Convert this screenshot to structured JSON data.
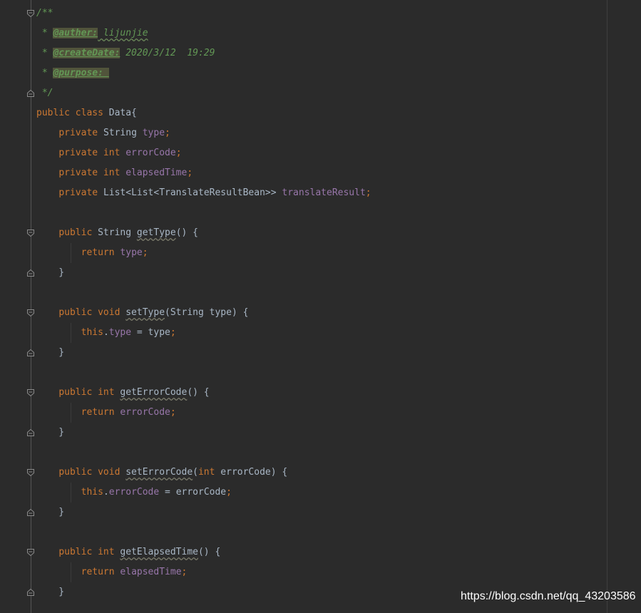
{
  "editor": {
    "lines": [
      {
        "fold": "open",
        "tokens": [
          [
            "cm",
            "/**"
          ]
        ]
      },
      {
        "tokens": [
          [
            "cm",
            " * "
          ],
          [
            "tag",
            "@auther:"
          ],
          [
            "cm-typo",
            " lijunjie"
          ]
        ]
      },
      {
        "tokens": [
          [
            "cm",
            " * "
          ],
          [
            "tag",
            "@createDate:"
          ],
          [
            "cm",
            " 2020/3/12  19:29"
          ]
        ]
      },
      {
        "tokens": [
          [
            "cm",
            " * "
          ],
          [
            "tag",
            "@purpose: "
          ]
        ]
      },
      {
        "fold": "close",
        "tokens": [
          [
            "cm",
            " */"
          ]
        ]
      },
      {
        "tokens": [
          [
            "kw",
            "public class "
          ],
          [
            "pl",
            "Data{"
          ]
        ]
      },
      {
        "tokens": [
          [
            "pl",
            "    "
          ],
          [
            "kw",
            "private "
          ],
          [
            "pl",
            "String "
          ],
          [
            "fld",
            "type"
          ],
          [
            "punc",
            ";"
          ]
        ]
      },
      {
        "tokens": [
          [
            "pl",
            "    "
          ],
          [
            "kw",
            "private int "
          ],
          [
            "fld",
            "errorCode"
          ],
          [
            "punc",
            ";"
          ]
        ]
      },
      {
        "tokens": [
          [
            "pl",
            "    "
          ],
          [
            "kw",
            "private int "
          ],
          [
            "fld",
            "elapsedTime"
          ],
          [
            "punc",
            ";"
          ]
        ]
      },
      {
        "tokens": [
          [
            "pl",
            "    "
          ],
          [
            "kw",
            "private "
          ],
          [
            "pl",
            "List<List<TranslateResultBean>> "
          ],
          [
            "fld",
            "translateResult"
          ],
          [
            "punc",
            ";"
          ]
        ]
      },
      {
        "tokens": []
      },
      {
        "fold": "open",
        "tokens": [
          [
            "pl",
            "    "
          ],
          [
            "kw",
            "public "
          ],
          [
            "pl",
            "String "
          ],
          [
            "meth",
            "getType"
          ],
          [
            "pl",
            "() {"
          ]
        ]
      },
      {
        "tokens": [
          [
            "pl",
            "        "
          ],
          [
            "kw",
            "return "
          ],
          [
            "fld",
            "type"
          ],
          [
            "punc",
            ";"
          ]
        ]
      },
      {
        "fold": "close",
        "tokens": [
          [
            "pl",
            "    }"
          ]
        ]
      },
      {
        "tokens": []
      },
      {
        "fold": "open",
        "tokens": [
          [
            "pl",
            "    "
          ],
          [
            "kw",
            "public void "
          ],
          [
            "meth",
            "setType"
          ],
          [
            "pl",
            "(String type) {"
          ]
        ]
      },
      {
        "tokens": [
          [
            "pl",
            "        "
          ],
          [
            "kw",
            "this"
          ],
          [
            "pl",
            "."
          ],
          [
            "fld",
            "type"
          ],
          [
            "pl",
            " = type"
          ],
          [
            "punc",
            ";"
          ]
        ]
      },
      {
        "fold": "close",
        "tokens": [
          [
            "pl",
            "    }"
          ]
        ]
      },
      {
        "tokens": []
      },
      {
        "fold": "open",
        "tokens": [
          [
            "pl",
            "    "
          ],
          [
            "kw",
            "public int "
          ],
          [
            "meth",
            "getErrorCode"
          ],
          [
            "pl",
            "() {"
          ]
        ]
      },
      {
        "tokens": [
          [
            "pl",
            "        "
          ],
          [
            "kw",
            "return "
          ],
          [
            "fld",
            "errorCode"
          ],
          [
            "punc",
            ";"
          ]
        ]
      },
      {
        "fold": "close",
        "tokens": [
          [
            "pl",
            "    }"
          ]
        ]
      },
      {
        "tokens": []
      },
      {
        "fold": "open",
        "tokens": [
          [
            "pl",
            "    "
          ],
          [
            "kw",
            "public void "
          ],
          [
            "meth",
            "setErrorCode"
          ],
          [
            "pl",
            "("
          ],
          [
            "kw",
            "int "
          ],
          [
            "pl",
            "errorCode) {"
          ]
        ]
      },
      {
        "tokens": [
          [
            "pl",
            "        "
          ],
          [
            "kw",
            "this"
          ],
          [
            "pl",
            "."
          ],
          [
            "fld",
            "errorCode"
          ],
          [
            "pl",
            " = errorCode"
          ],
          [
            "punc",
            ";"
          ]
        ]
      },
      {
        "fold": "close",
        "tokens": [
          [
            "pl",
            "    }"
          ]
        ]
      },
      {
        "tokens": []
      },
      {
        "fold": "open",
        "tokens": [
          [
            "pl",
            "    "
          ],
          [
            "kw",
            "public int "
          ],
          [
            "meth",
            "getElapsedTime"
          ],
          [
            "pl",
            "() {"
          ]
        ]
      },
      {
        "tokens": [
          [
            "pl",
            "        "
          ],
          [
            "kw",
            "return "
          ],
          [
            "fld",
            "elapsedTime"
          ],
          [
            "punc",
            ";"
          ]
        ]
      },
      {
        "fold": "close",
        "tokens": [
          [
            "pl",
            "    }"
          ]
        ]
      }
    ],
    "colors": {
      "background": "#2b2b2b",
      "keyword": "#cc7832",
      "field": "#9876aa",
      "plain": "#a9b7c6",
      "comment": "#629755",
      "tag_highlight": "#51543b"
    }
  },
  "watermark": "https://blog.csdn.net/qq_43203586"
}
